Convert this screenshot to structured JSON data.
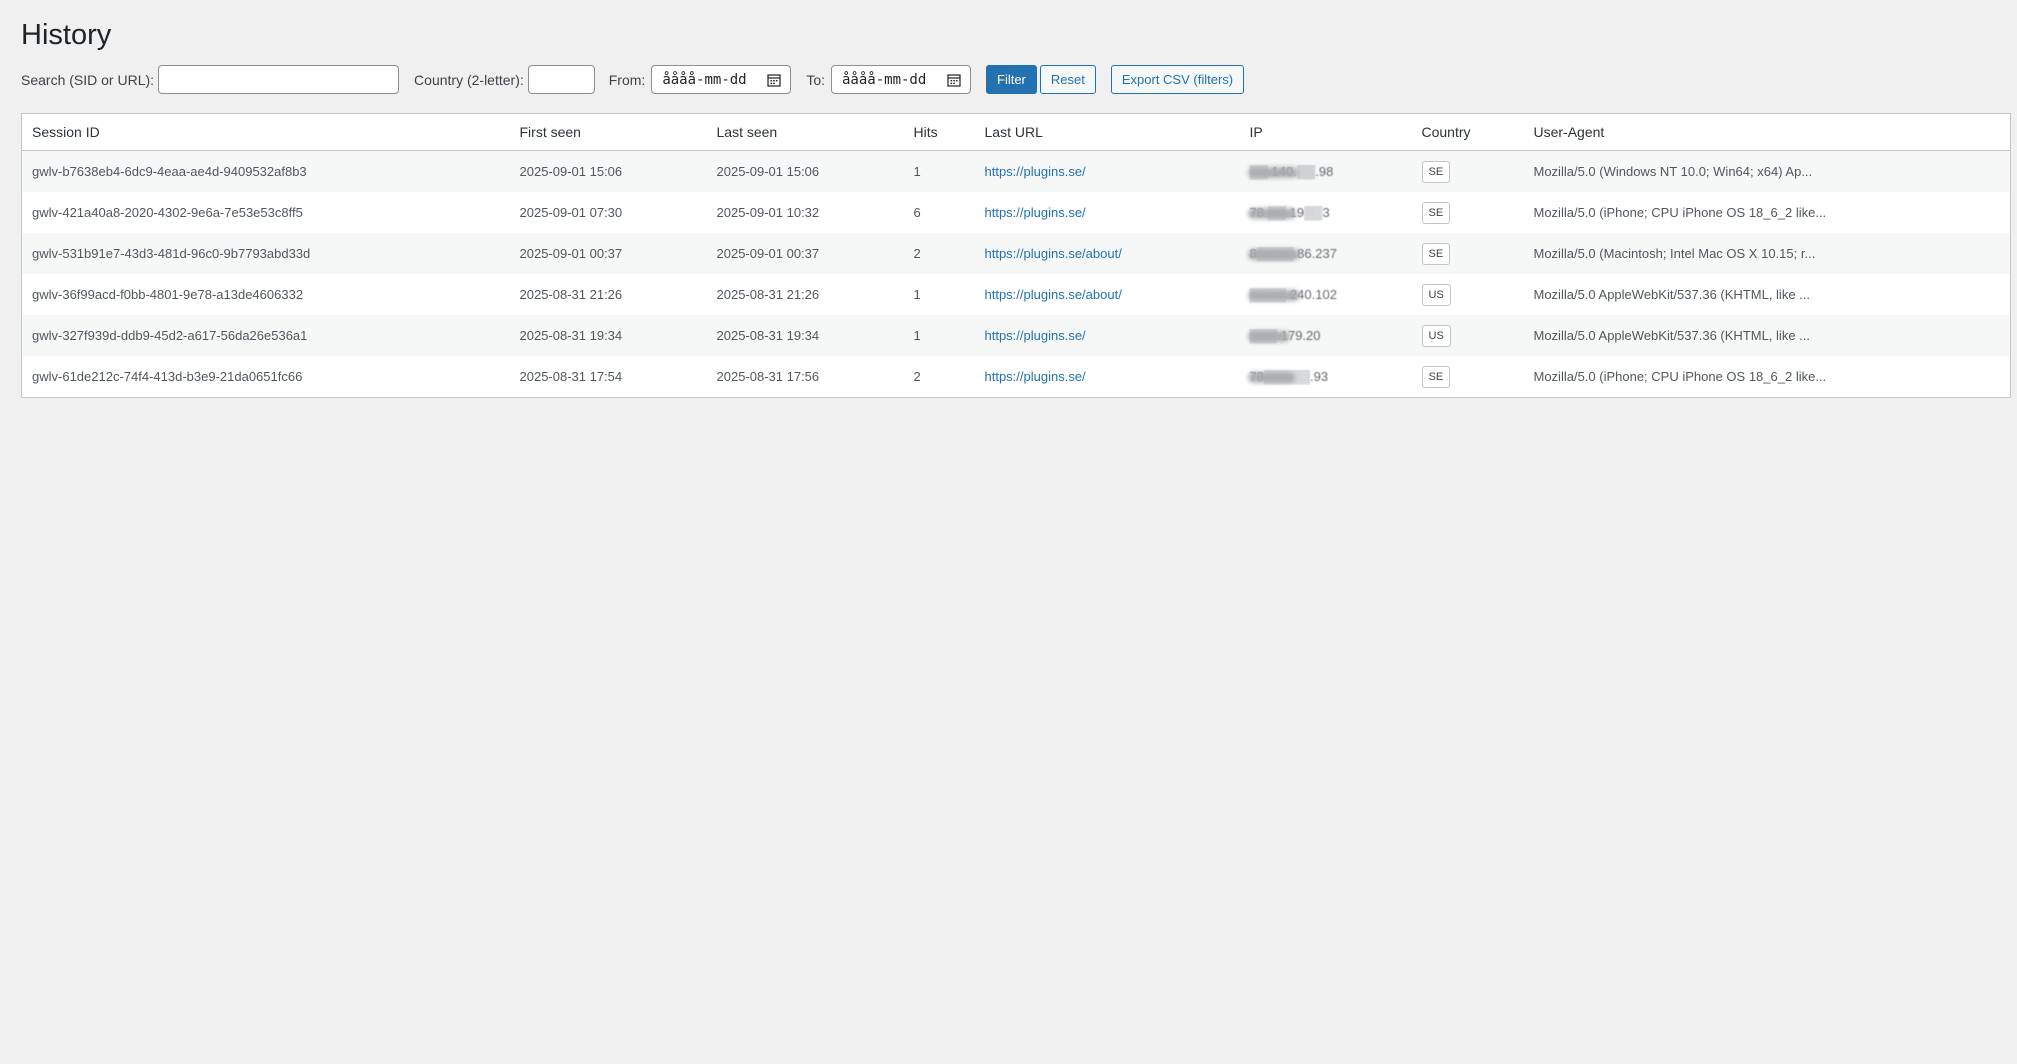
{
  "page": {
    "title": "History"
  },
  "filters": {
    "search_label": "Search (SID or URL):",
    "search_value": "",
    "country_label": "Country (2-letter):",
    "country_value": "",
    "from_label": "From:",
    "from_placeholder": "åååå-mm-dd",
    "to_label": "To:",
    "to_placeholder": "åååå-mm-dd",
    "filter_button": "Filter",
    "reset_button": "Reset",
    "export_button": "Export CSV (filters)"
  },
  "table": {
    "columns": [
      "Session ID",
      "First seen",
      "Last seen",
      "Hits",
      "Last URL",
      "IP",
      "Country",
      "User-Agent"
    ],
    "rows": [
      {
        "sid": "gwlv-b7638eb4-6dc9-4eaa-ae4d-9409532af8b3",
        "first": "2025-09-01 15:06",
        "last": "2025-09-01 15:06",
        "hits": "1",
        "url": "https://plugins.se/",
        "ip": "▒▒.140.▒▒.98",
        "country": "SE",
        "ua": "Mozilla/5.0 (Windows NT 10.0; Win64; x64) Ap..."
      },
      {
        "sid": "gwlv-421a40a8-2020-4302-9e6a-7e53e53c8ff5",
        "first": "2025-09-01 07:30",
        "last": "2025-09-01 10:32",
        "hits": "6",
        "url": "https://plugins.se/",
        "ip": "78.▒▒.19▒▒3",
        "country": "SE",
        "ua": "Mozilla/5.0 (iPhone; CPU iPhone OS 18_6_2 like..."
      },
      {
        "sid": "gwlv-531b91e7-43d3-481d-96c0-9b7793abd33d",
        "first": "2025-09-01 00:37",
        "last": "2025-09-01 00:37",
        "hits": "2",
        "url": "https://plugins.se/about/",
        "ip": "8▒▒▒▒.86.237",
        "country": "SE",
        "ua": "Mozilla/5.0 (Macintosh; Intel Mac OS X 10.15; r..."
      },
      {
        "sid": "gwlv-36f99acd-f0bb-4801-9e78-a13de4606332",
        "first": "2025-08-31 21:26",
        "last": "2025-08-31 21:26",
        "hits": "1",
        "url": "https://plugins.se/about/",
        "ip": "▒▒▒▒.240.102",
        "country": "US",
        "ua": "Mozilla/5.0 AppleWebKit/537.36 (KHTML, like ..."
      },
      {
        "sid": "gwlv-327f939d-ddb9-45d2-a617-56da26e536a1",
        "first": "2025-08-31 19:34",
        "last": "2025-08-31 19:34",
        "hits": "1",
        "url": "https://plugins.se/",
        "ip": "▒▒▒.179.20",
        "country": "US",
        "ua": "Mozilla/5.0 AppleWebKit/537.36 (KHTML, like ..."
      },
      {
        "sid": "gwlv-61de212c-74f4-413d-b3e9-21da0651fc66",
        "first": "2025-08-31 17:54",
        "last": "2025-08-31 17:56",
        "hits": "2",
        "url": "https://plugins.se/",
        "ip": "78▒▒▒▒▒.93",
        "country": "SE",
        "ua": "Mozilla/5.0 (iPhone; CPU iPhone OS 18_6_2 like..."
      }
    ]
  },
  "colors": {
    "accent": "#2271b1",
    "background": "#f0f0f1"
  }
}
